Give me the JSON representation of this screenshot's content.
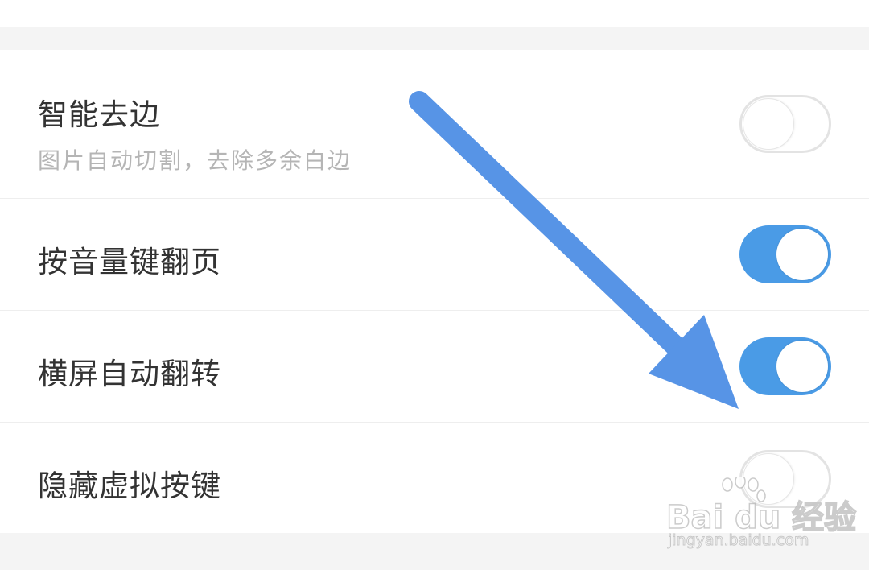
{
  "settings": {
    "items": [
      {
        "title": "智能去边",
        "subtitle": "图片自动切割，去除多余白边",
        "enabled": false
      },
      {
        "title": "按音量键翻页",
        "enabled": true
      },
      {
        "title": "横屏自动翻转",
        "enabled": true
      },
      {
        "title": "隐藏虚拟按键",
        "enabled": false
      }
    ]
  },
  "annotation": {
    "icon": "arrow-down-right-icon",
    "color": "#5794e6"
  },
  "watermark": {
    "logo_text": "Bai du 经验",
    "url": "jingyan.baidu.com"
  },
  "colors": {
    "toggle_on": "#4a9be6",
    "toggle_off_border": "#e3e3e3",
    "section_gap": "#f4f4f4"
  }
}
